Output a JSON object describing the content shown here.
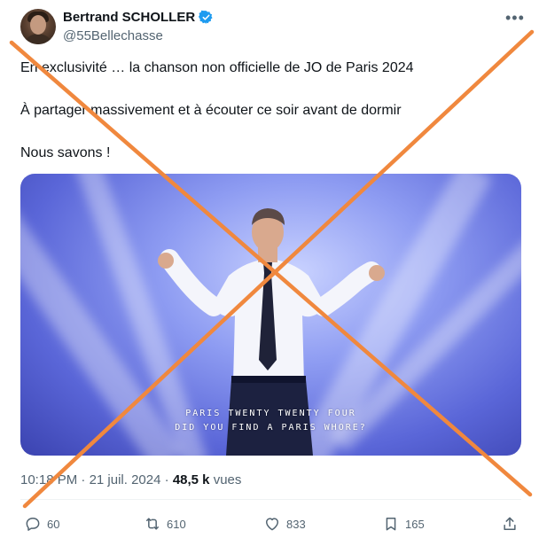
{
  "author": {
    "name": "Bertrand SCHOLLER",
    "handle": "@55Bellechasse"
  },
  "tweet": {
    "line1": "En exclusivité … la chanson non officielle de JO de Paris 2024",
    "line2": "À partager massivement et à écouter ce soir avant de dormir",
    "line3": "Nous savons !"
  },
  "media": {
    "caption_line1": "PARIS TWENTY TWENTY FOUR",
    "caption_line2": "DID YOU FIND A PARIS WHORE?"
  },
  "meta": {
    "time": "10:18 PM",
    "date": "21 juil. 2024",
    "views_count": "48,5 k",
    "views_label": "vues"
  },
  "actions": {
    "replies": "60",
    "reposts": "610",
    "likes": "833",
    "bookmarks": "165"
  },
  "colors": {
    "overlay_cross": "#f0883e",
    "verified_badge": "#1d9bf0"
  },
  "icons": [
    "verified-badge-icon",
    "more-icon",
    "reply-icon",
    "repost-icon",
    "like-icon",
    "bookmark-icon",
    "share-icon"
  ]
}
